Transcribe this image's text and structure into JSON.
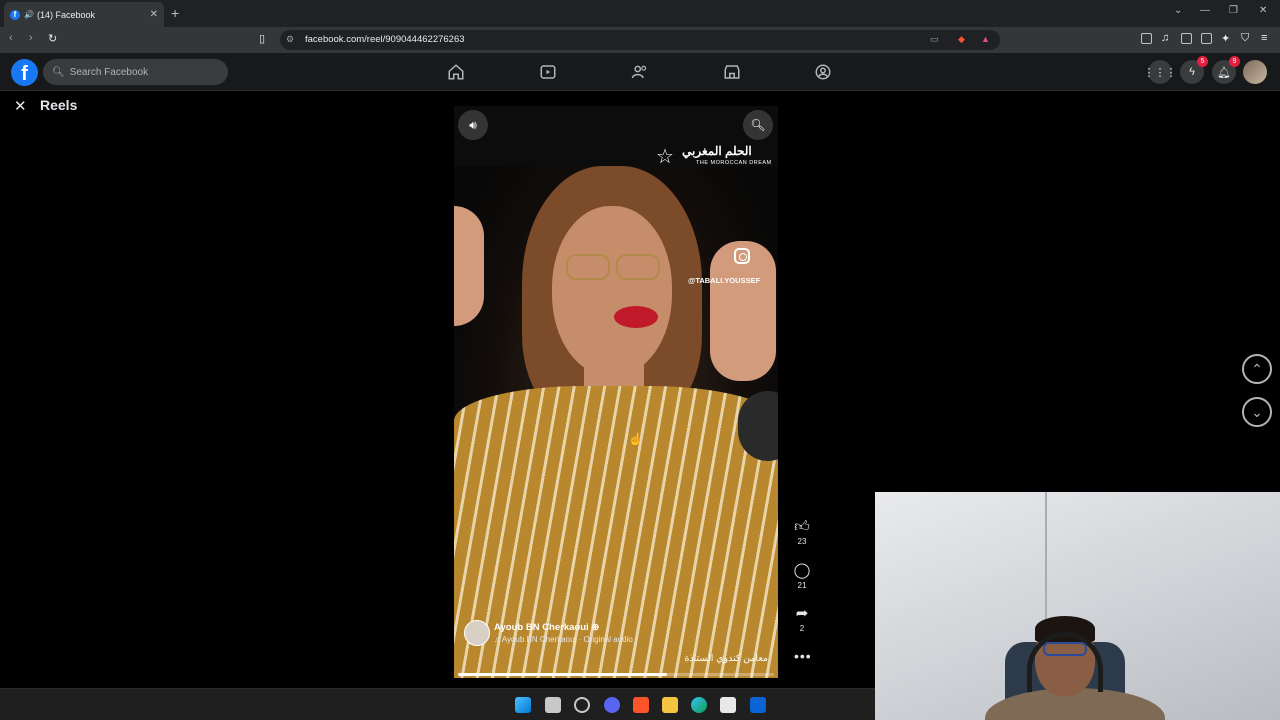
{
  "browser": {
    "tab_title": "(14) Facebook",
    "url": "facebook.com/reel/909044462276263"
  },
  "facebook": {
    "search_placeholder": "Search Facebook",
    "messenger_badge": "5",
    "notifications_badge": "9"
  },
  "reels": {
    "title": "Reels",
    "watermark_arabic": "الحلم المغربي",
    "watermark_english": "THE MOROCCAN DREAM",
    "instagram_handle": "@TABALI.YOUSSEF",
    "author_name": "Ayoub BN Cherkaoui",
    "audio": "Ayoub BN Cherkaoui · Original audio",
    "caption": "معامن كندوي الستاذة",
    "likes": "23",
    "comments": "21",
    "shares": "2",
    "progress": 0.66
  },
  "colors": {
    "facebook_blue": "#1877f2",
    "badge_red": "#e41e3f"
  }
}
